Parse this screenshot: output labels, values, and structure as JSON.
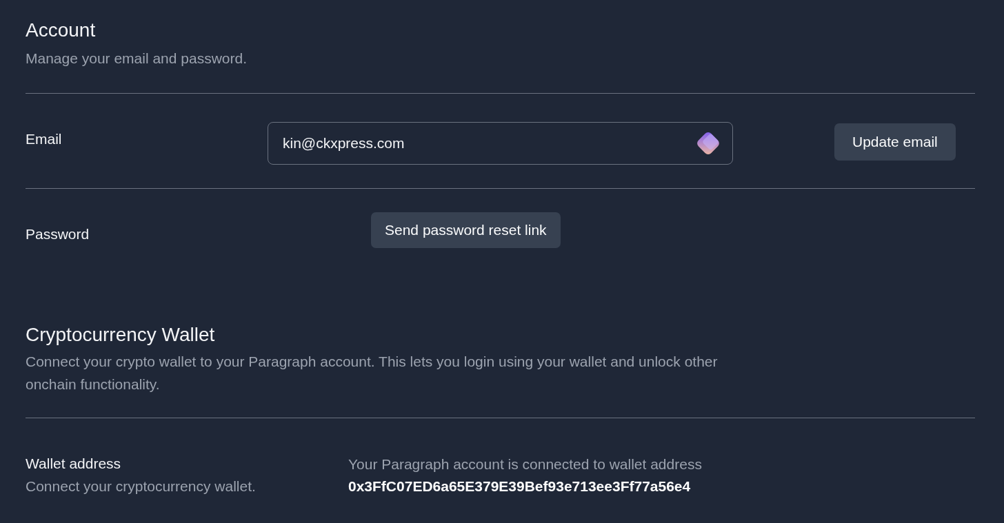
{
  "account": {
    "title": "Account",
    "subtitle": "Manage your email and password.",
    "email": {
      "label": "Email",
      "value": "kin@ckxpress.com",
      "button": "Update email"
    },
    "password": {
      "label": "Password",
      "button": "Send password reset link"
    }
  },
  "wallet": {
    "title": "Cryptocurrency Wallet",
    "subtitle": "Connect your crypto wallet to your Paragraph account. This lets you login using your wallet and unlock other onchain functionality.",
    "address_row": {
      "label": "Wallet address",
      "hint": "Connect your cryptocurrency wallet.",
      "status": "Your Paragraph account is connected to wallet address",
      "address": "0x3FfC07ED6a65E379E39Bef93e713ee3Ff77a56e4"
    }
  }
}
